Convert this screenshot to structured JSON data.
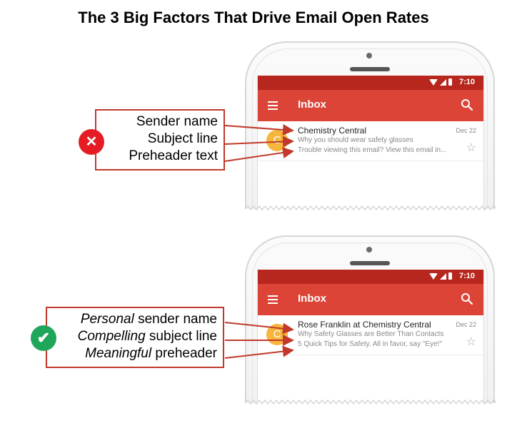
{
  "title": "The 3 Big Factors That Drive Email Open Rates",
  "panels": {
    "bad": {
      "status_time": "7:10",
      "app_title": "Inbox",
      "labels": [
        {
          "emphasis": "",
          "text": "Sender name"
        },
        {
          "emphasis": "",
          "text": "Subject line"
        },
        {
          "emphasis": "",
          "text": "Preheader text"
        }
      ],
      "badge_icon": "x-mark-icon",
      "badge_color": "#e51c23",
      "email": {
        "avatar": "C",
        "sender": "Chemistry Central",
        "date": "Dec 22",
        "subject": "Why you should wear safety glasses",
        "preheader": "Trouble viewing this email? View this email in..."
      }
    },
    "good": {
      "status_time": "7:10",
      "app_title": "Inbox",
      "labels": [
        {
          "emphasis": "Personal",
          "text": " sender name"
        },
        {
          "emphasis": "Compelling",
          "text": " subject line"
        },
        {
          "emphasis": "Meaningful",
          "text": " preheader"
        }
      ],
      "badge_icon": "check-mark-icon",
      "badge_color": "#1fa65a",
      "email": {
        "avatar": "C",
        "sender": "Rose Franklin at Chemistry Central",
        "date": "Dec 22",
        "subject": "Why Safety Glasses are Better Than Contacts",
        "preheader": "5 Quick Tips for Safety. All in favor, say \"Eye!\""
      }
    }
  },
  "colors": {
    "status_bar": "#b8271d",
    "app_bar": "#db4437",
    "arrow": "#c0392b",
    "avatar": "#f6b73c"
  }
}
